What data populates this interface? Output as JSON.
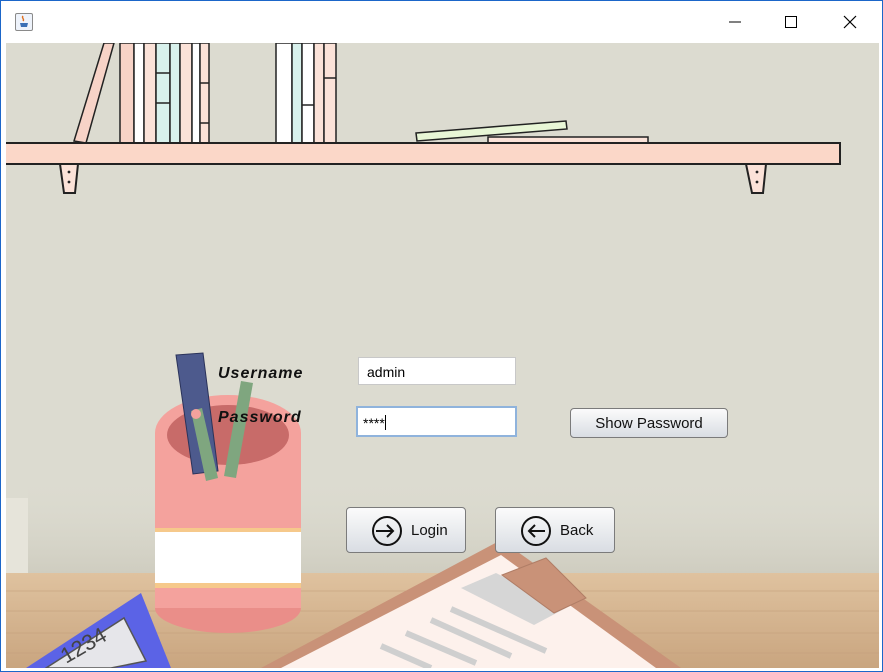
{
  "window": {
    "app_icon": "java-cup-icon",
    "controls": [
      "minimize-icon",
      "maximize-icon",
      "close-icon"
    ]
  },
  "form": {
    "username_label": "Username",
    "password_label": "Password",
    "username_value": "admin",
    "password_value": "****",
    "show_password_label": "Show Password",
    "login_label": "Login",
    "back_label": "Back"
  },
  "scene": {
    "calculator_display": "1234"
  },
  "colors": {
    "background": "#dcdbd0",
    "shelf": "#fbd7c8",
    "desk": "#d9b896",
    "cup": "#f4a29d",
    "clipboard": "#c99278",
    "calculator": "#5b63e6",
    "focus_border": "#8fb3dc"
  }
}
